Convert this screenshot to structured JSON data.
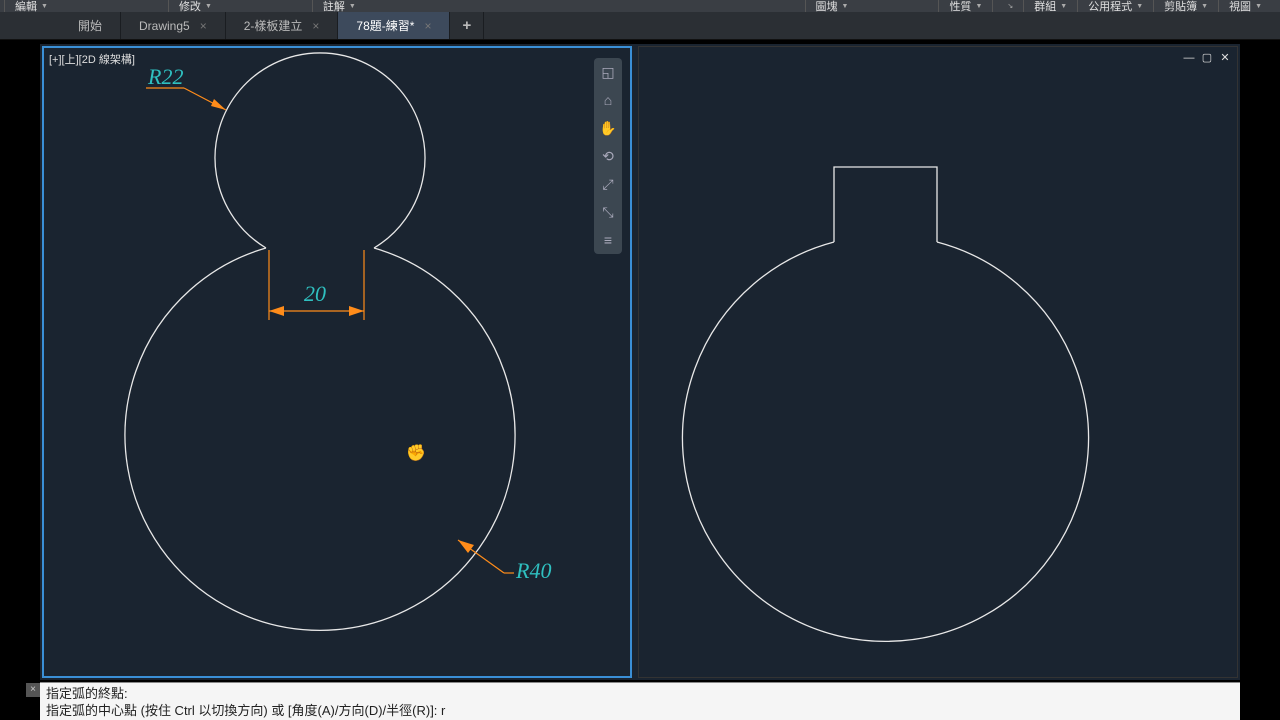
{
  "menu_left": [
    "編輯",
    "修改",
    "註解"
  ],
  "menu_right": [
    "圖塊",
    "性質",
    "",
    "群組",
    "公用程式",
    "剪貼簿",
    "視圖"
  ],
  "tabs": [
    {
      "label": "開始",
      "active": false
    },
    {
      "label": "Drawing5",
      "active": false
    },
    {
      "label": "2-樣板建立",
      "active": false
    },
    {
      "label": "78題-練習*",
      "active": true
    }
  ],
  "newtab_label": "+",
  "viewport_label": "[+][上][2D 線架構]",
  "window_controls": {
    "min": "—",
    "max": "▢",
    "close": "✕"
  },
  "nav_icons": [
    "◱",
    "⌂",
    "✋",
    "⟲",
    "⤢",
    "⤡",
    "≡"
  ],
  "dimensions": {
    "top_radius": "R22",
    "gap_width": "20",
    "bottom_radius": "R40"
  },
  "command": {
    "line1": "指定弧的終點:",
    "line2": "指定弧的中心點 (按住 Ctrl 以切換方向) 或 [角度(A)/方向(D)/半徑(R)]: r"
  }
}
